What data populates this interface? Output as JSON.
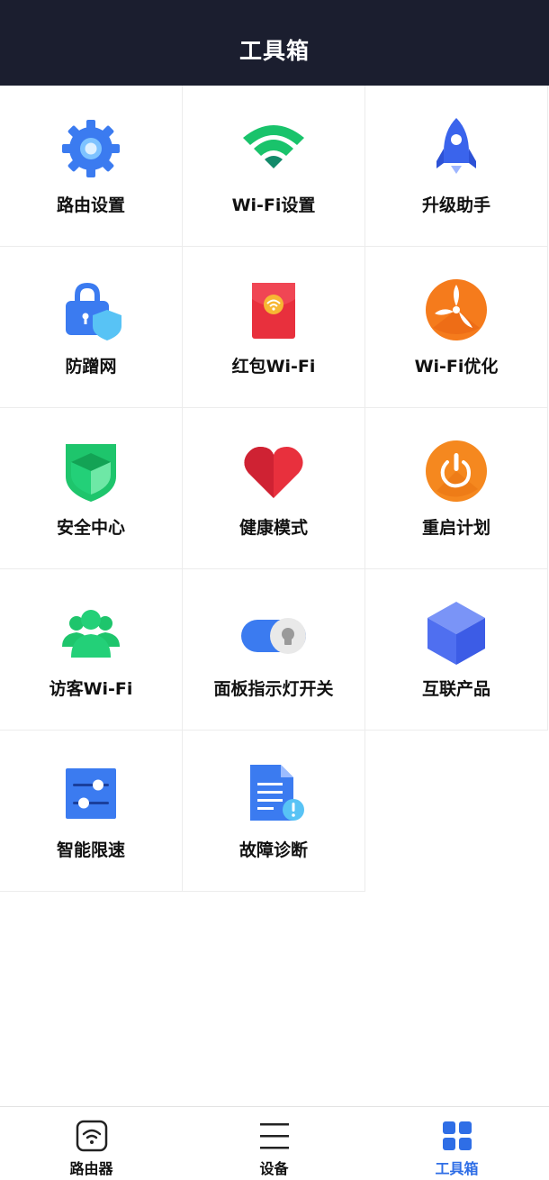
{
  "header": {
    "title": "工具箱"
  },
  "tools": [
    {
      "label": "路由设置",
      "icon": "gear-icon",
      "color": "#3b7bf0"
    },
    {
      "label": "Wi-Fi设置",
      "icon": "wifi-icon",
      "color": "#19c36b"
    },
    {
      "label": "升级助手",
      "icon": "rocket-icon",
      "color": "#3a64ec"
    },
    {
      "label": "防蹭网",
      "icon": "lock-shield-icon",
      "color": "#3b7bf0"
    },
    {
      "label": "红包Wi-Fi",
      "icon": "red-envelope-wifi-icon",
      "color": "#e8303d"
    },
    {
      "label": "Wi-Fi优化",
      "icon": "fan-icon",
      "color": "#f57b1c"
    },
    {
      "label": "安全中心",
      "icon": "security-shield-icon",
      "color": "#1ec56c"
    },
    {
      "label": "健康模式",
      "icon": "heart-icon",
      "color": "#e8303d"
    },
    {
      "label": "重启计划",
      "icon": "power-icon",
      "color": "#f5881f"
    },
    {
      "label": "访客Wi-Fi",
      "icon": "guests-icon",
      "color": "#1ec56c"
    },
    {
      "label": "面板指示灯开关",
      "icon": "light-toggle-icon",
      "color": "#3b7bf0"
    },
    {
      "label": "互联产品",
      "icon": "cube-icon",
      "color": "#5b7cf2"
    },
    {
      "label": "智能限速",
      "icon": "speed-limit-sliders-icon",
      "color": "#3b7bf0"
    },
    {
      "label": "故障诊断",
      "icon": "diagnosis-document-icon",
      "color": "#3b7bf0"
    }
  ],
  "tabbar": {
    "items": [
      {
        "label": "路由器",
        "icon": "router-wifi-icon",
        "active": false
      },
      {
        "label": "设备",
        "icon": "menu-lines-icon",
        "active": false
      },
      {
        "label": "工具箱",
        "icon": "grid-tiles-icon",
        "active": true
      }
    ],
    "active_color": "#2f6ee6"
  }
}
